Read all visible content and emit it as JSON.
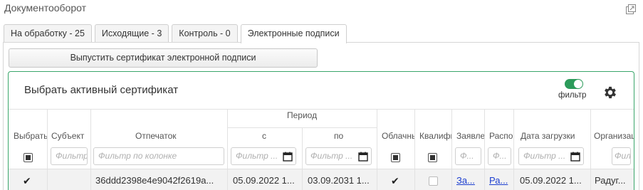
{
  "window": {
    "title": "Документооборот"
  },
  "tabs": [
    {
      "label": "На обработку - 25"
    },
    {
      "label": "Исходящие - 3"
    },
    {
      "label": "Контроль - 0"
    },
    {
      "label": "Электронные подписи"
    }
  ],
  "issue_button": {
    "label": "Выпустить сертификат электронной подписи"
  },
  "card": {
    "title": "Выбрать активный сертификат",
    "filter_toggle": {
      "label": "фильтр",
      "on": true
    },
    "accent_color": "#3aa66a"
  },
  "table": {
    "group_header": "Период",
    "columns": {
      "select": "Выбрать",
      "subject": "Субъект",
      "thumbprint": "Отпечаток",
      "from": "с",
      "to": "по",
      "cloud": "Облачный",
      "qualified": "Квалифицированный",
      "application": "Заявление",
      "order": "Распоряжение",
      "upload_date": "Дата загрузки",
      "organization": "Организация"
    },
    "filters": {
      "subject": "Фильтр",
      "thumbprint": "Фильтр по колонке",
      "from": "Фильтр ...",
      "to": "Фильтр ...",
      "application": "Ф...",
      "order": "Ф...",
      "upload_date": "Фильтр ...",
      "organization": "Фил..."
    },
    "rows": [
      {
        "selected": true,
        "subject": "",
        "thumbprint": "36ddd2398e4e9042f2619a...",
        "from": "05.09.2022 1...",
        "to": "03.09.2031 1...",
        "cloud": true,
        "qualified": false,
        "application": "За...",
        "order": "Ра...",
        "upload_date": "05.09.2022 1...",
        "organization": "Радуг..."
      }
    ]
  }
}
